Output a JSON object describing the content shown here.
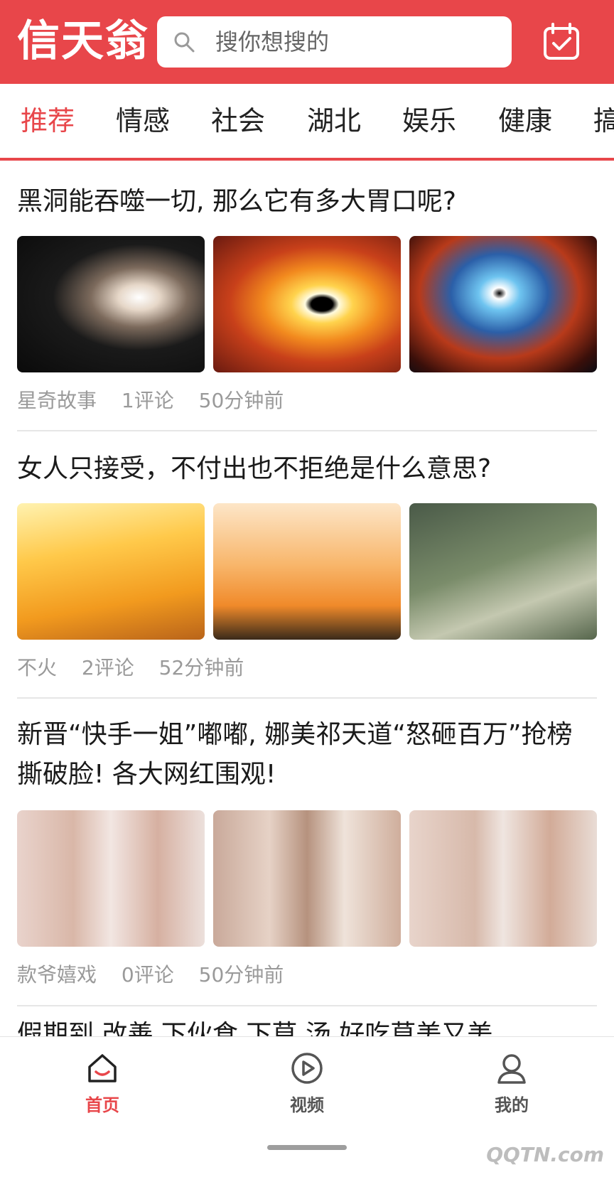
{
  "header": {
    "logo": "信天翁",
    "search_placeholder": "搜你想搜的",
    "bg_color": "#e8464a"
  },
  "tabs": [
    "推荐",
    "情感",
    "社会",
    "湖北",
    "娱乐",
    "健康",
    "搞"
  ],
  "articles": [
    {
      "title": "黑洞能吞噬一切, 那么它有多大胃口呢?",
      "source": "星奇故事",
      "comments": "1评论",
      "time": "50分钟前"
    },
    {
      "title": "女人只接受，不付出也不拒绝是什么意思?",
      "source": "不火",
      "comments": "2评论",
      "time": "52分钟前"
    },
    {
      "title": "新晋“快手一姐”嘟嘟, 娜美祁天道“怒砸百万”抢榜撕破脸! 各大网红围观!",
      "source": "款爷嬉戏",
      "comments": "0评论",
      "time": "50分钟前"
    }
  ],
  "partial_next_title": "假期到 改善 下伙食 下草 汤 好吃草美又美",
  "bottom_nav": [
    {
      "label": "首页",
      "icon": "home-icon",
      "active": true
    },
    {
      "label": "视频",
      "icon": "video-icon",
      "active": false
    },
    {
      "label": "我的",
      "icon": "profile-icon",
      "active": false
    }
  ],
  "watermark": "QQTN.com",
  "colors": {
    "accent": "#e8464a",
    "meta": "#9a9a9a"
  }
}
